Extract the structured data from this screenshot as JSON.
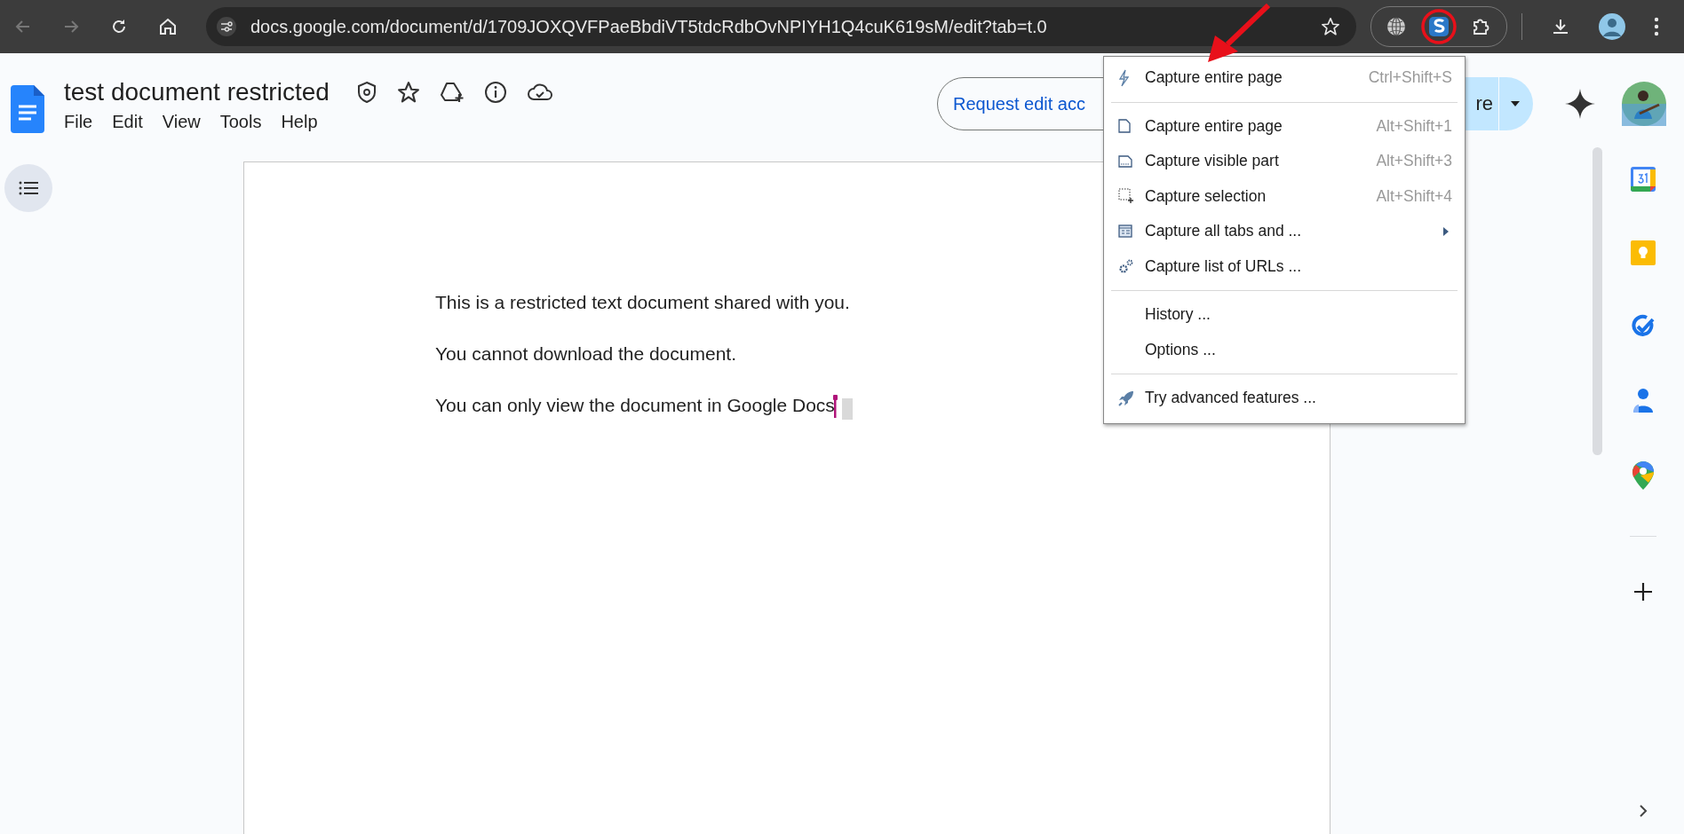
{
  "browser": {
    "url": "docs.google.com/document/d/1709JOXQVFPaeBbdiVT5tdcRdbOvNPIYH1Q4cuK619sM/edit?tab=t.0"
  },
  "docs": {
    "title": "test document restricted",
    "menu": [
      "File",
      "Edit",
      "View",
      "Tools",
      "Help"
    ],
    "request_button": "Request edit acc",
    "share_button": "re"
  },
  "document": {
    "paragraphs": [
      "This is a restricted text document shared with you.",
      "You cannot download the document.",
      "You can only view the document in Google Docs"
    ]
  },
  "extension_menu": {
    "groups": [
      [
        {
          "label": "Capture entire page",
          "shortcut": "Ctrl+Shift+S",
          "submenu": false
        }
      ],
      [
        {
          "label": "Capture entire page",
          "shortcut": "Alt+Shift+1",
          "submenu": false
        },
        {
          "label": "Capture visible part",
          "shortcut": "Alt+Shift+3",
          "submenu": false
        },
        {
          "label": "Capture selection",
          "shortcut": "Alt+Shift+4",
          "submenu": false
        },
        {
          "label": "Capture all tabs and ...",
          "submenu": true
        },
        {
          "label": "Capture list of URLs ...",
          "submenu": false
        }
      ],
      [
        {
          "label": "History ...",
          "submenu": false
        },
        {
          "label": "Options ...",
          "submenu": false
        }
      ],
      [
        {
          "label": "Try advanced features ...",
          "submenu": false
        }
      ]
    ]
  }
}
